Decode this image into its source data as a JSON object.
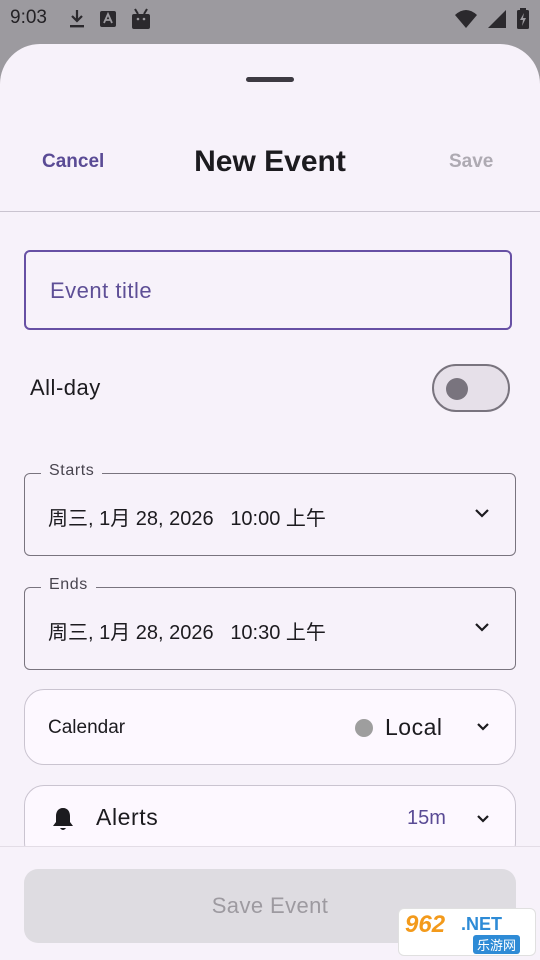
{
  "status_bar": {
    "time": "9:03",
    "left_icons": [
      "download-icon",
      "translate-icon",
      "android-icon"
    ],
    "right_icons": [
      "wifi-icon",
      "signal-icon",
      "battery-icon"
    ]
  },
  "header": {
    "cancel_label": "Cancel",
    "title": "New Event",
    "save_label": "Save"
  },
  "form": {
    "title_placeholder": "Event title",
    "allday": {
      "label": "All-day",
      "enabled": false
    },
    "starts": {
      "label": "Starts",
      "value": "周三, 1月 28, 2026   10:00 上午"
    },
    "ends": {
      "label": "Ends",
      "value": "周三, 1月 28, 2026   10:30 上午"
    },
    "calendar": {
      "label": "Calendar",
      "value": "Local",
      "color": "#9e9e9e"
    },
    "alerts": {
      "label": "Alerts",
      "value": "15m"
    }
  },
  "footer": {
    "save_event_label": "Save Event"
  },
  "watermark": {
    "big": "962",
    "net": ".NET",
    "sub": "乐游网"
  },
  "colors": {
    "accent": "#6750a4",
    "sheet_background": "#f7f2fa",
    "scrim": "#9c9a9f"
  }
}
